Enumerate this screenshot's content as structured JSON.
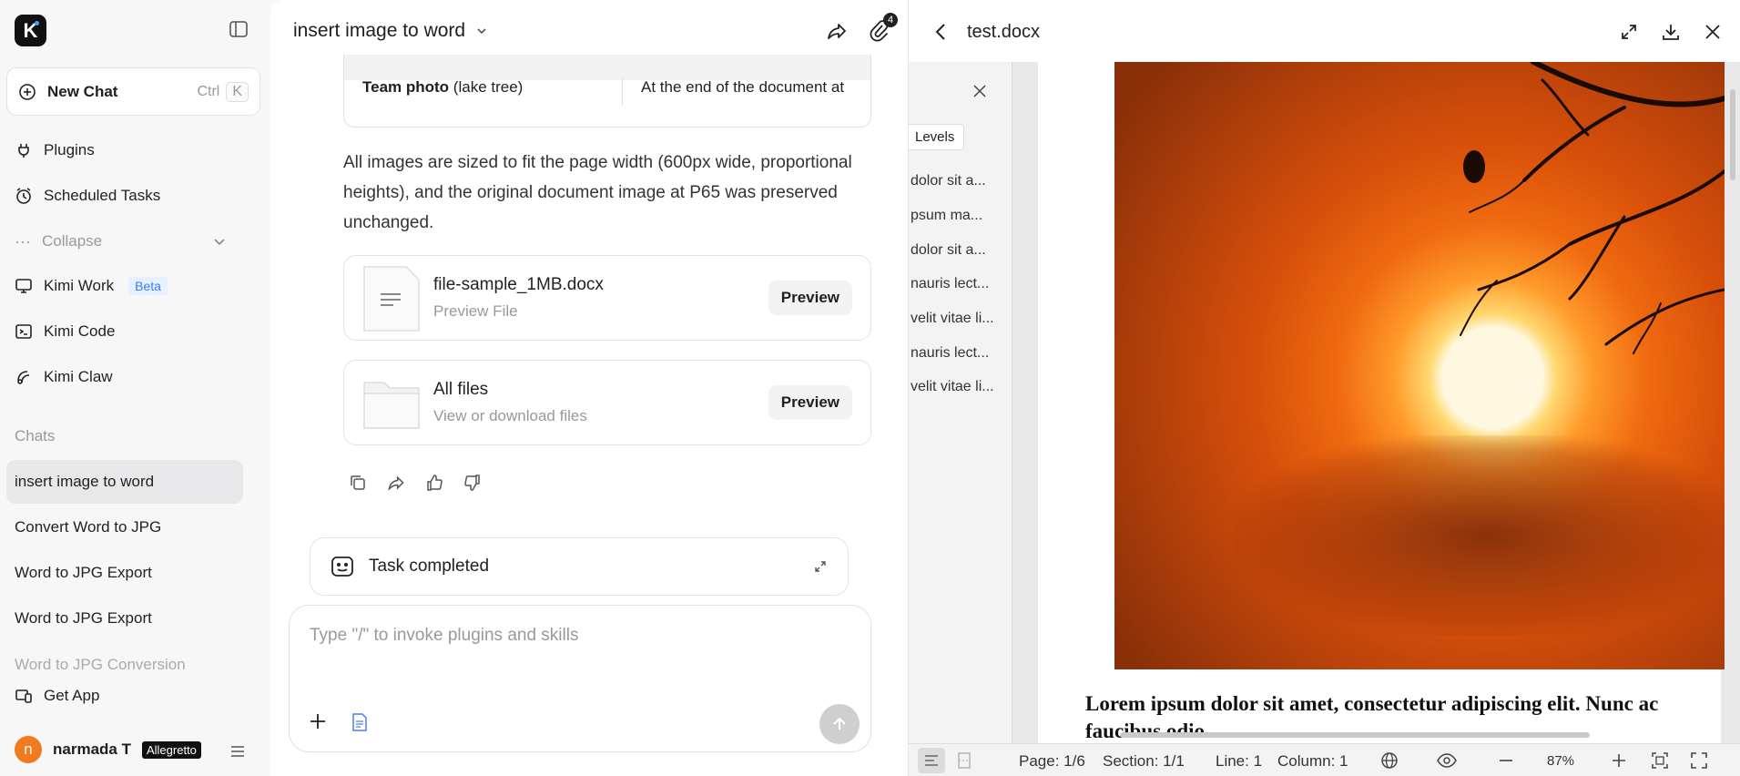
{
  "sidebar": {
    "logo_letter": "K",
    "new_chat": {
      "label": "New Chat",
      "shortcut_ctrl": "Ctrl",
      "shortcut_key": "K"
    },
    "nav": {
      "plugins": "Plugins",
      "scheduled": "Scheduled Tasks",
      "collapse": "Collapse",
      "kimi_work": "Kimi Work",
      "beta": "Beta",
      "kimi_code": "Kimi Code",
      "kimi_claw": "Kimi Claw"
    },
    "chats_label": "Chats",
    "chats": [
      "insert image to word",
      "Convert Word to JPG",
      "Word to JPG Export",
      "Word to JPG Export",
      "Word to JPG Conversion"
    ],
    "get_app": "Get App",
    "user": {
      "initial": "n",
      "name": "narmada T",
      "plan": "Allegretto"
    }
  },
  "chat": {
    "title": "insert image to word",
    "attachment_count": "4",
    "table": {
      "cell1_bold": "Team photo",
      "cell1_rest": " (lake tree)",
      "cell2": "At the end of the document at"
    },
    "paragraph": "All images are sized to fit the page width (600px wide, proportional heights), and the original document image at P65 was preserved unchanged.",
    "files": [
      {
        "title": "file-sample_1MB.docx",
        "subtitle": "Preview File",
        "button": "Preview"
      },
      {
        "title": "All files",
        "subtitle": "View or download files",
        "button": "Preview"
      }
    ],
    "task_status": "Task completed",
    "composer_placeholder": "Type \"/\" to invoke plugins and skills"
  },
  "preview": {
    "file_name": "test.docx",
    "levels_label": "Levels",
    "headings": [
      "dolor sit a...",
      "psum ma...",
      "dolor sit a...",
      "nauris lect...",
      "velit vitae li...",
      "nauris lect...",
      "velit vitae li..."
    ],
    "doc_text": "Lorem ipsum dolor sit amet, consectetur adipiscing elit. Nunc ac faucibus odio.",
    "status": {
      "page": "Page: 1/6",
      "section": "Section: 1/1",
      "line": "Line: 1",
      "column": "Column: 1",
      "zoom": "87%"
    }
  }
}
